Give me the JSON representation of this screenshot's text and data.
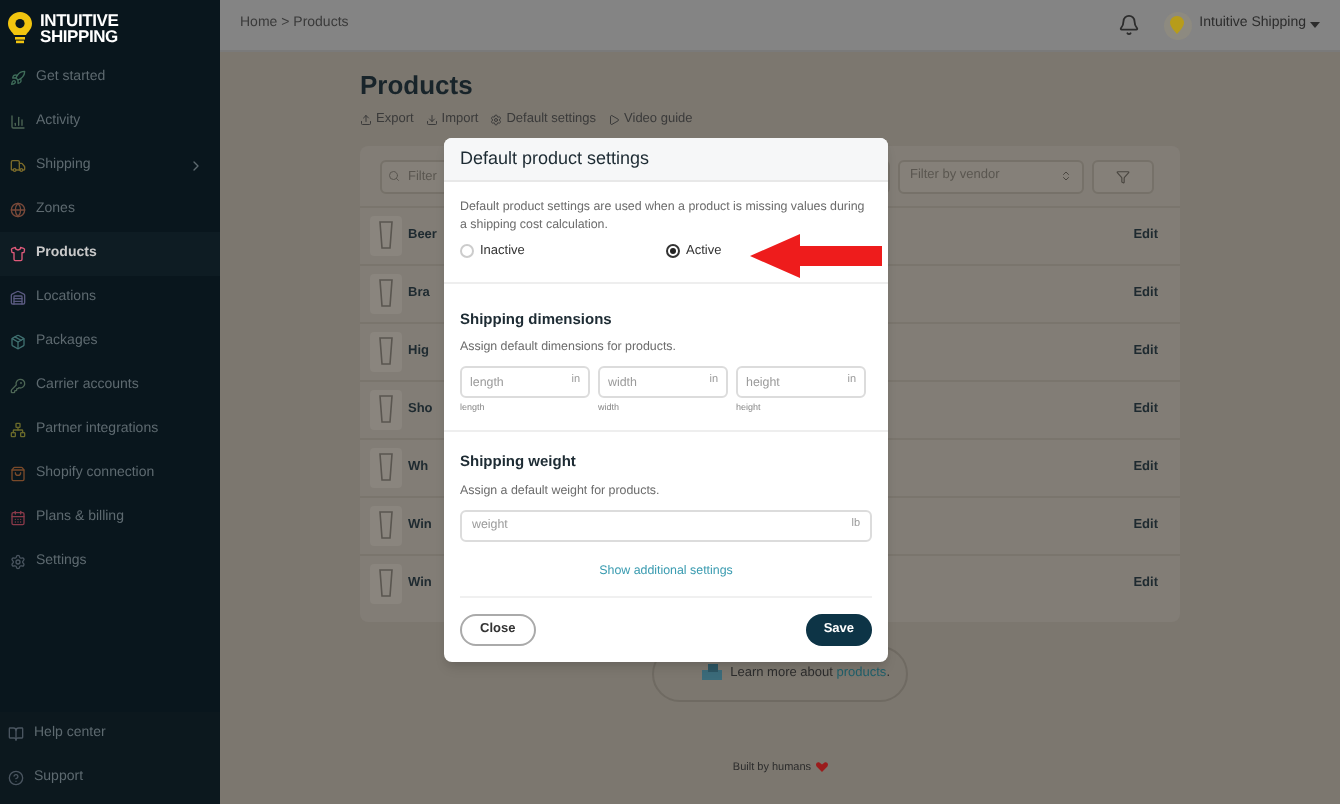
{
  "brand": {
    "line_1": "INTUITIVE",
    "line_2": "SHIPPING"
  },
  "sidebar": {
    "items": [
      {
        "label": "Get started",
        "selected": false,
        "has_submenu": false
      },
      {
        "label": "Activity",
        "selected": false,
        "has_submenu": false
      },
      {
        "label": "Shipping",
        "selected": false,
        "has_submenu": true
      },
      {
        "label": "Zones",
        "selected": false,
        "has_submenu": false
      },
      {
        "label": "Products",
        "selected": true,
        "has_submenu": false
      },
      {
        "label": "Locations",
        "selected": false,
        "has_submenu": false
      },
      {
        "label": "Packages",
        "selected": false,
        "has_submenu": false
      },
      {
        "label": "Carrier accounts",
        "selected": false,
        "has_submenu": false
      },
      {
        "label": "Partner integrations",
        "selected": false,
        "has_submenu": false
      },
      {
        "label": "Shopify connection",
        "selected": false,
        "has_submenu": false
      },
      {
        "label": "Plans & billing",
        "selected": false,
        "has_submenu": false
      },
      {
        "label": "Settings",
        "selected": false,
        "has_submenu": false
      }
    ],
    "footer_items": [
      {
        "label": "Help center"
      },
      {
        "label": "Support"
      }
    ]
  },
  "header": {
    "breadcrumb": "Home > Products",
    "account": "Intuitive Shipping"
  },
  "page": {
    "title": "Products",
    "actions": [
      {
        "label": "Export"
      },
      {
        "label": "Import"
      },
      {
        "label": "Default settings"
      },
      {
        "label": "Video guide"
      }
    ],
    "filters": {
      "search_placeholder": "Filter",
      "vendor_placeholder": "Filter by vendor"
    },
    "rows": [
      {
        "name": "Beer",
        "action": "Edit"
      },
      {
        "name": "Bra",
        "action": "Edit"
      },
      {
        "name": "Hig",
        "action": "Edit"
      },
      {
        "name": "Sho",
        "action": "Edit"
      },
      {
        "name": "Wh",
        "action": "Edit"
      },
      {
        "name": "Win",
        "action": "Edit"
      },
      {
        "name": "Win",
        "action": "Edit"
      }
    ],
    "learn_more": "Learn more about **products**.",
    "footer": "Built by humans"
  },
  "dialog": {
    "title": "Default product settings",
    "description": "Default product settings are used when a product is missing values during a shipping cost calculation.",
    "status_options": [
      {
        "label": "Inactive",
        "selected": false
      },
      {
        "label": "Active",
        "selected": true
      }
    ],
    "dimensions": {
      "heading": "Shipping dimensions",
      "hint": "Assign default dimensions for products.",
      "fields": [
        {
          "placeholder": "length",
          "unit": "in",
          "caption": "length"
        },
        {
          "placeholder": "width",
          "unit": "in",
          "caption": "width"
        },
        {
          "placeholder": "height",
          "unit": "in",
          "caption": "height"
        }
      ]
    },
    "weight": {
      "heading": "Shipping weight",
      "hint": "Assign a default weight for products.",
      "placeholder": "weight",
      "unit": "lb"
    },
    "more_link": "Show additional settings",
    "buttons": [
      {
        "label": "Close",
        "kind": "secondary"
      },
      {
        "label": "Save",
        "kind": "primary"
      }
    ]
  }
}
